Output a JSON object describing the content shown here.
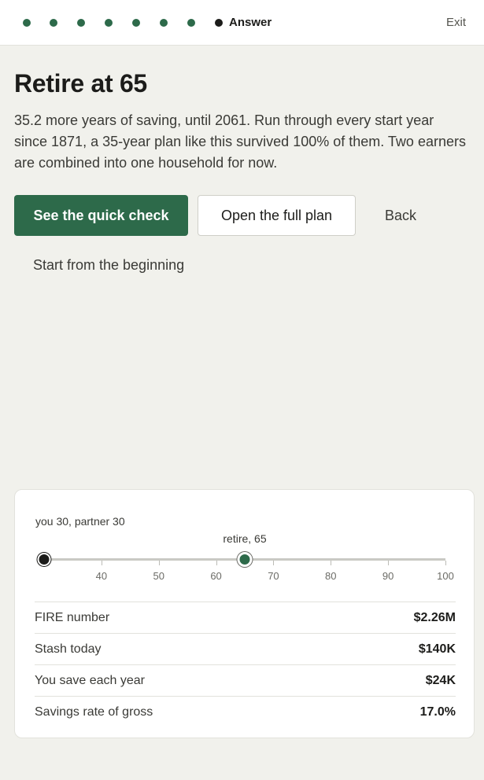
{
  "progress": {
    "completed_steps": 7,
    "current_label": "Answer"
  },
  "header": {
    "exit_label": "Exit"
  },
  "main": {
    "title": "Retire at 65",
    "summary": "35.2 more years of saving, until 2061. Run through every start year since 1871, a 35-year plan like this survived 100% of them. Two earners are combined into one household for now.",
    "buttons": {
      "quick_check": "See the quick check",
      "full_plan": "Open the full plan",
      "back": "Back",
      "restart": "Start from the beginning"
    }
  },
  "card": {
    "ages_label": "you 30, partner 30",
    "retire_label": "retire, 65",
    "slider": {
      "min_age": 30,
      "max_age": 100,
      "current_age": 30,
      "retire_age": 65,
      "ticks": [
        "40",
        "50",
        "60",
        "70",
        "80",
        "90",
        "100"
      ]
    },
    "stats": [
      {
        "label": "FIRE number",
        "value": "$2.26M"
      },
      {
        "label": "Stash today",
        "value": "$140K"
      },
      {
        "label": "You save each year",
        "value": "$24K"
      },
      {
        "label": "Savings rate of gross",
        "value": "17.0%"
      }
    ]
  },
  "colors": {
    "accent": "#2d6a4a",
    "background": "#f1f1ec"
  }
}
